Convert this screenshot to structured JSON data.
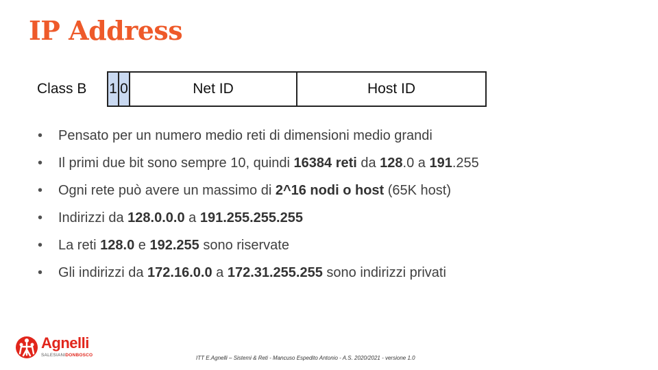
{
  "title": "IP Address",
  "class_diagram": {
    "label": "Class B",
    "bit1": "1",
    "bit2": "0",
    "net_id": "Net ID",
    "host_id": "Host ID",
    "bit_fill_color": "#c9d9f1"
  },
  "bullets": [
    {
      "parts": [
        {
          "t": "Pensato per un numero medio reti di dimensioni medio grandi"
        }
      ]
    },
    {
      "parts": [
        {
          "t": "Il primi due bit sono sempre 10, quindi "
        },
        {
          "t": "16384 reti",
          "b": true
        },
        {
          "t": " da "
        },
        {
          "t": "128",
          "b": true
        },
        {
          "t": ".0 a "
        },
        {
          "t": "191",
          "b": true
        },
        {
          "t": ".255"
        }
      ]
    },
    {
      "parts": [
        {
          "t": "Ogni rete può avere un massimo di "
        },
        {
          "t": "2^16 nodi o host",
          "b": true
        },
        {
          "t": " (65K host)"
        }
      ]
    },
    {
      "parts": [
        {
          "t": "Indirizzi da "
        },
        {
          "t": "128.0.0.0",
          "b": true
        },
        {
          "t": " a "
        },
        {
          "t": "191.255.255.255",
          "b": true
        }
      ]
    },
    {
      "parts": [
        {
          "t": "La reti "
        },
        {
          "t": "128.0",
          "b": true
        },
        {
          "t": "  e "
        },
        {
          "t": "192.255",
          "b": true
        },
        {
          "t": " sono riservate"
        }
      ]
    },
    {
      "parts": [
        {
          "t": "Gli indirizzi da "
        },
        {
          "t": "172.16.0.0",
          "b": true
        },
        {
          "t": " a "
        },
        {
          "t": "172.31.255.255",
          "b": true
        },
        {
          "t": " sono indirizzi privati"
        }
      ]
    }
  ],
  "logo": {
    "name": "Agnelli",
    "sub_a": "SALESIANI",
    "sub_b": "DONBOSCO"
  },
  "footer": "ITT E.Agnelli – Sistemi & Reti - Mancuso Espedito Antonio - A.S. 2020/2021 - versione 1.0",
  "colors": {
    "title": "#ee5a2a",
    "logo_red": "#e1251b"
  }
}
